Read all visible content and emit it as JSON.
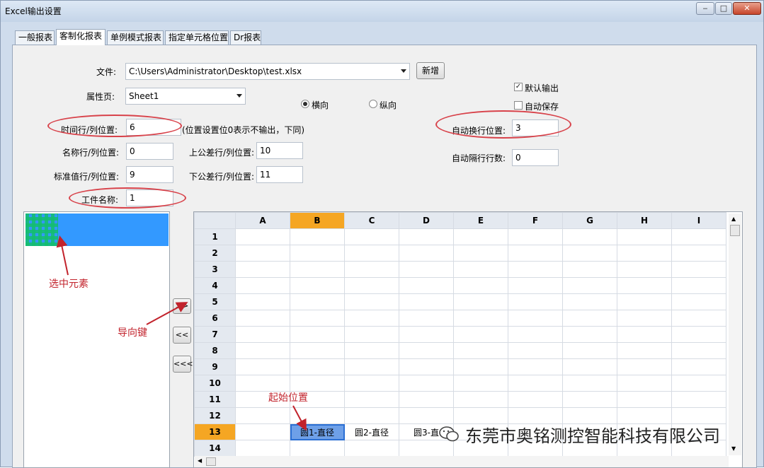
{
  "window": {
    "title": "Excel输出设置"
  },
  "tabs": [
    {
      "label": "一般报表"
    },
    {
      "label": "客制化报表"
    },
    {
      "label": "单例模式报表"
    },
    {
      "label": "指定单元格位置"
    },
    {
      "label": "Dr报表"
    }
  ],
  "form": {
    "file_label": "文件:",
    "file_value": "C:\\Users\\Administrator\\Desktop\\test.xlsx",
    "new_button": "新增",
    "sheet_label": "属性页:",
    "sheet_value": "Sheet1",
    "orientation": {
      "horizontal": "横向",
      "vertical": "纵向",
      "selected": "横向"
    },
    "default_output": {
      "label": "默认输出",
      "checked": true
    },
    "auto_save": {
      "label": "自动保存",
      "checked": false
    },
    "time_label": "时间行/列位置:",
    "time_value": "6",
    "time_hint": "(位置设置位0表示不输出，下同)",
    "name_label": "名称行/列位置:",
    "name_value": "0",
    "upper_tol_label": "上公差行/列位置:",
    "upper_tol_value": "10",
    "std_label": "标准值行/列位置:",
    "std_value": "9",
    "lower_tol_label": "下公差行/列位置:",
    "lower_tol_value": "11",
    "part_label": "工件名称:",
    "part_value": "1",
    "auto_wrap_label": "自动换行位置:",
    "auto_wrap_value": "3",
    "auto_gap_label": "自动隔行行数:",
    "auto_gap_value": "0"
  },
  "nav_buttons": {
    "forward": ">>",
    "back": "<<",
    "back_all": "<<<"
  },
  "annotations": {
    "selected_element": "选中元素",
    "nav_key": "导向键",
    "start_position": "起始位置"
  },
  "sheet": {
    "columns": [
      "A",
      "B",
      "C",
      "D",
      "E",
      "F",
      "G",
      "H",
      "I"
    ],
    "rows": [
      "1",
      "2",
      "3",
      "4",
      "5",
      "6",
      "7",
      "8",
      "9",
      "10",
      "11",
      "12",
      "13",
      "14"
    ],
    "row13": {
      "B": "圆1-直径",
      "C": "圆2-直径",
      "D": "圆3-直"
    }
  },
  "watermark": "东莞市奥铭测控智能科技有限公司",
  "colors": {
    "accent": "#f5a623",
    "annotation": "#c2232c",
    "selection": "#3399ff"
  }
}
